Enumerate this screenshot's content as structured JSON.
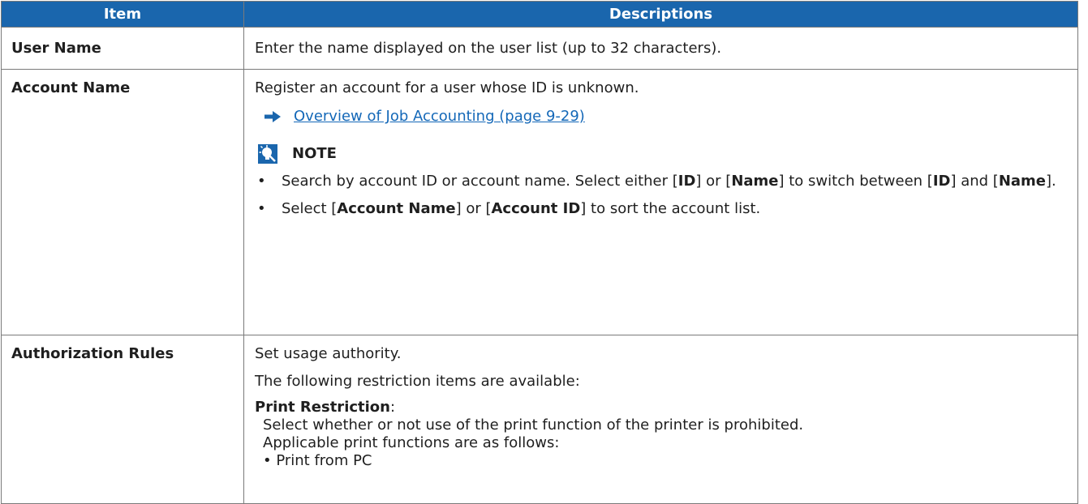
{
  "table": {
    "headers": [
      "Item",
      "Descriptions"
    ],
    "rows": {
      "user_name": {
        "item": "User Name",
        "desc": "Enter the name displayed on the user list (up to 32 characters)."
      },
      "account_name": {
        "item": "Account Name",
        "desc": "Register an account for a user whose ID is unknown.",
        "link": "Overview of Job Accounting (page 9-29)",
        "note_title": "NOTE",
        "bullet1": {
          "a": "Search by account ID or account name. Select either [",
          "b": "ID",
          "c": "] or [",
          "d": "Name",
          "e": "] to switch between [",
          "f": "ID",
          "g": "] and [",
          "h": "Name",
          "i": "]."
        },
        "bullet2": {
          "a": "Select [",
          "b": "Account Name",
          "c": "] or [",
          "d": "Account ID",
          "e": "] to sort the account list."
        }
      },
      "authorization_rules": {
        "item": "Authorization Rules",
        "line1": "Set usage authority.",
        "line2": "The following restriction items are available:",
        "sub_title": "Print Restriction",
        "sub_colon": ":",
        "sub_text1": "Select whether or not use of the print function of the printer is prohibited.",
        "sub_text2": "Applicable print functions are as follows:",
        "sub_text3": "• Print from PC"
      }
    }
  },
  "colors": {
    "header_bg": "#1a66ad",
    "link": "#1468b8",
    "border": "#7a7a7a"
  },
  "icons": {
    "link_arrow": "arrow-right-icon",
    "note": "lightbulb-note-icon"
  }
}
